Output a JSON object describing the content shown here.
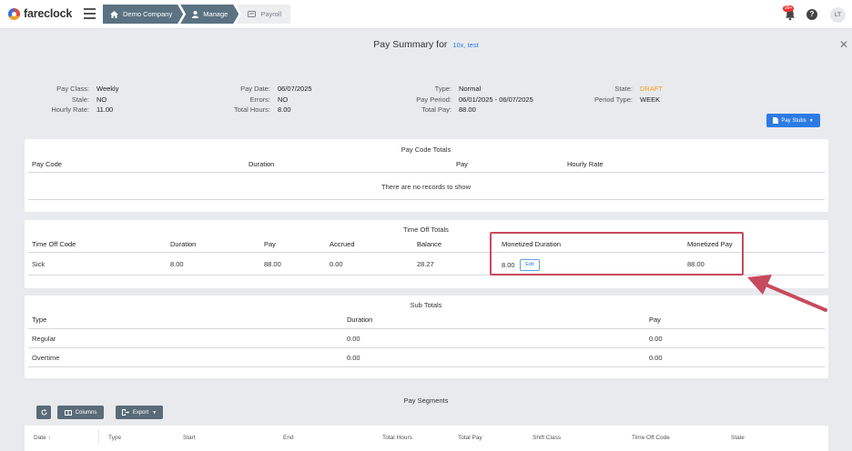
{
  "app": {
    "name": "fareclock"
  },
  "breadcrumbs": [
    "Demo Company",
    "Manage",
    "Payroll"
  ],
  "header": {
    "notification_count": "99+",
    "help": "?",
    "avatar_initials": "LT"
  },
  "page": {
    "title": "Pay Summary for",
    "employee": "10x, test"
  },
  "summary": {
    "pay_class_label": "Pay Class:",
    "pay_class": "Weekly",
    "stale_label": "Stale:",
    "stale": "NO",
    "hourly_rate_label": "Hourly Rate:",
    "hourly_rate": "11.00",
    "pay_date_label": "Pay Date:",
    "pay_date": "06/07/2025",
    "errors_label": "Errors:",
    "errors": "NO",
    "total_hours_label": "Total Hours:",
    "total_hours": "8.00",
    "type_label": "Type:",
    "type": "Normal",
    "pay_period_label": "Pay Period:",
    "pay_period": "06/01/2025 - 06/07/2025",
    "total_pay_label": "Total Pay:",
    "total_pay": "88.00",
    "state_label": "State:",
    "state": "DRAFT",
    "period_type_label": "Period Type:",
    "period_type": "WEEK"
  },
  "pay_stubs_button": "Pay Stubs",
  "pay_code_totals": {
    "title": "Pay Code Totals",
    "columns": [
      "Pay Code",
      "Duration",
      "Pay",
      "Hourly Rate"
    ],
    "empty_message": "There are no records to show"
  },
  "time_off_totals": {
    "title": "Time Off Totals",
    "columns": [
      "Time Off Code",
      "Duration",
      "Pay",
      "Accrued",
      "Balance",
      "Monetized Duration",
      "Monetized Pay"
    ],
    "rows": [
      {
        "code": "Sick",
        "duration": "8.00",
        "pay": "88.00",
        "accrued": "0.00",
        "balance": "28.27",
        "monetized_duration": "8.00",
        "monetized_pay": "88.00"
      }
    ],
    "edit_label": "Edit"
  },
  "sub_totals": {
    "title": "Sub Totals",
    "columns": [
      "Type",
      "Duration",
      "Pay"
    ],
    "rows": [
      {
        "type": "Regular",
        "duration": "0.00",
        "pay": "0.00"
      },
      {
        "type": "Overtime",
        "duration": "0.00",
        "pay": "0.00"
      }
    ]
  },
  "pay_segments": {
    "title": "Pay Segments",
    "columns_button": "Columns",
    "export_button": "Export",
    "columns": [
      "Date",
      "Type",
      "Start",
      "End",
      "Total Hours",
      "Total Pay",
      "Shift Class",
      "Time Off Code",
      "Stale"
    ],
    "sort_indicator": "↑"
  },
  "colors": {
    "accent": "#2c7be5",
    "breadcrumb": "#5a7282",
    "draft": "#f0a020",
    "highlight": "#c84a5e"
  }
}
